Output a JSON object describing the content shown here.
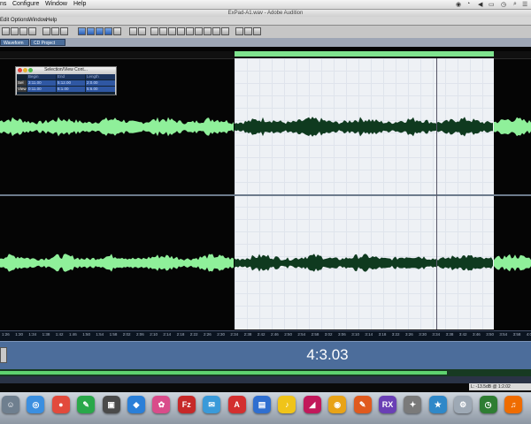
{
  "menubar": {
    "items": [
      "ns",
      "Configure",
      "Window",
      "Help"
    ]
  },
  "window": {
    "title": "ExPad-A1.wav - Adobe Audition"
  },
  "app_menu": {
    "items": [
      "Edit",
      "Options",
      "Window",
      "Help"
    ]
  },
  "tabs": [
    "Waveform View",
    "CD Project View"
  ],
  "selection_view_panel": {
    "title": "Selection/View Cont...",
    "columns": [
      "Begin",
      "End",
      "Length"
    ],
    "rows": [
      {
        "label": "Sel",
        "begin": "3:11.00",
        "end": "5:12.00",
        "length": "2:0.00"
      },
      {
        "label": "View",
        "begin": "0:11.00",
        "end": "6:1.00",
        "length": "5:6.00"
      }
    ]
  },
  "time_display": "4:3.03",
  "timeline": {
    "ticks": [
      "1:26",
      "1:30",
      "1:34",
      "1:38",
      "1:42",
      "1:46",
      "1:50",
      "1:54",
      "1:58",
      "2:02",
      "2:06",
      "2:10",
      "2:14",
      "2:18",
      "2:22",
      "2:26",
      "2:30",
      "2:34",
      "2:38",
      "2:42",
      "2:46",
      "2:50",
      "2:54",
      "2:58",
      "3:02",
      "3:06",
      "3:10",
      "3:14",
      "3:18",
      "3:22",
      "3:26",
      "3:30",
      "3:34",
      "3:38",
      "3:42",
      "3:46",
      "3:50",
      "3:54",
      "3:58",
      "4:02"
    ]
  },
  "status": {
    "text": "L: -13.5dB @ 1:2.02"
  },
  "colors": {
    "waveform": "#8ff09a",
    "waveform_selected": "#0f3a1f",
    "selection_bg": "#eef1f5",
    "transport": "#4c6d9b"
  },
  "dock": {
    "apps": [
      "finder-icon",
      "safari-icon",
      "chrome-icon",
      "evernote-icon",
      "facetime-icon",
      "dropbox-icon",
      "photos-icon",
      "filezilla-icon",
      "mail-icon",
      "acrobat-icon",
      "preview-icon",
      "itunes-icon",
      "pdf-icon",
      "firefox-icon",
      "audition-icon",
      "rx-icon",
      "fire-icon",
      "imovie-icon",
      "settings-icon",
      "timemachine-icon",
      "garageband-icon"
    ]
  }
}
